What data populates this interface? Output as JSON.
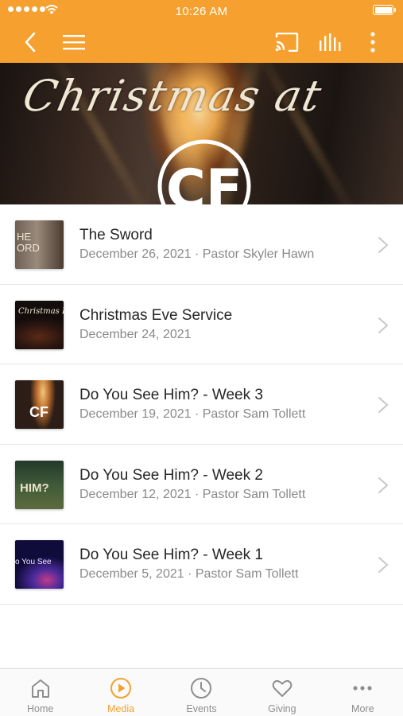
{
  "status_bar": {
    "time": "10:26 AM"
  },
  "hero": {
    "title": "Christmas at",
    "logo_text": "CF"
  },
  "sermons": [
    {
      "title": "The Sword",
      "subtitle": "December 26, 2021 · Pastor Skyler Hawn",
      "thumb_text": "HE\nORD"
    },
    {
      "title": "Christmas Eve Service",
      "subtitle": "December 24, 2021",
      "thumb_text": "Christmas E"
    },
    {
      "title": "Do You See Him? - Week 3",
      "subtitle": "December 19, 2021 · Pastor Sam Tollett",
      "thumb_text": "CF"
    },
    {
      "title": "Do You See Him? - Week 2",
      "subtitle": "December 12, 2021 · Pastor Sam Tollett",
      "thumb_text": "HIM?"
    },
    {
      "title": "Do You See Him? - Week 1",
      "subtitle": "December 5, 2021 · Pastor Sam Tollett",
      "thumb_text": "o You See"
    }
  ],
  "tabs": [
    {
      "label": "Home",
      "icon": "home-icon"
    },
    {
      "label": "Media",
      "icon": "play-circle-icon",
      "active": true
    },
    {
      "label": "Events",
      "icon": "clock-icon"
    },
    {
      "label": "Giving",
      "icon": "heart-icon"
    },
    {
      "label": "More",
      "icon": "more-dots-icon"
    }
  ],
  "colors": {
    "accent": "#f6a12f",
    "tab_inactive": "#8e8e8e",
    "subtitle": "#8a8a8a"
  }
}
